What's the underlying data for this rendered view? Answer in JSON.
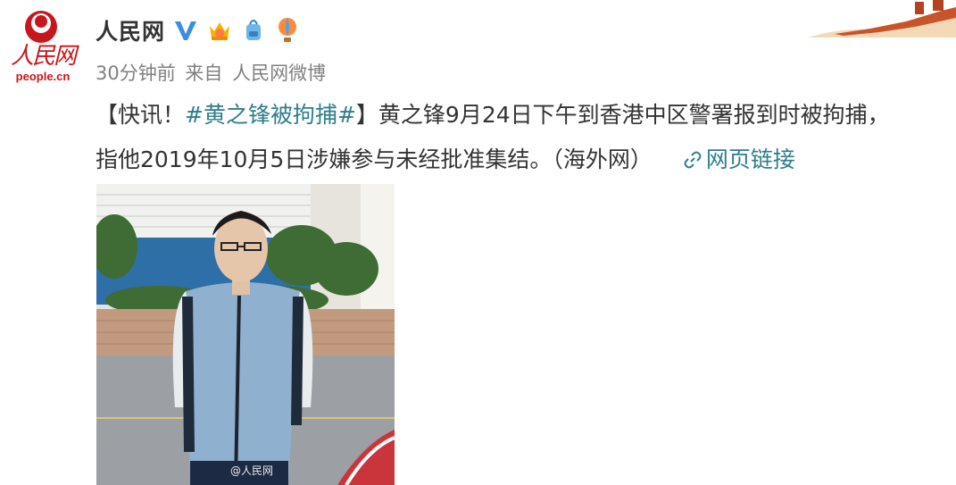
{
  "account": {
    "name": "人民网",
    "avatar_script": "人民网",
    "avatar_domain": "people.cn",
    "verified_icon": "verified-v-icon",
    "badges": [
      "crown-badge-icon",
      "bag-badge-icon",
      "balloon-badge-icon"
    ]
  },
  "meta": {
    "time": "30分钟前",
    "source_prefix": "来自",
    "source": "人民网微博"
  },
  "post": {
    "open": "【快讯！",
    "hashtag": "#黄之锋被拘捕#",
    "close": "】黄之锋9月24日下午到香港中区警署报到时被拘捕，",
    "line2": "指他2019年10月5日涉嫌参与未经批准集结。（海外网）",
    "link_label": "网页链接"
  },
  "image": {
    "watermark": "@人民网"
  },
  "colors": {
    "link": "#2e7e8a",
    "meta": "#808080",
    "brand_red": "#c8161d",
    "verified_blue": "#3a8ee6"
  }
}
